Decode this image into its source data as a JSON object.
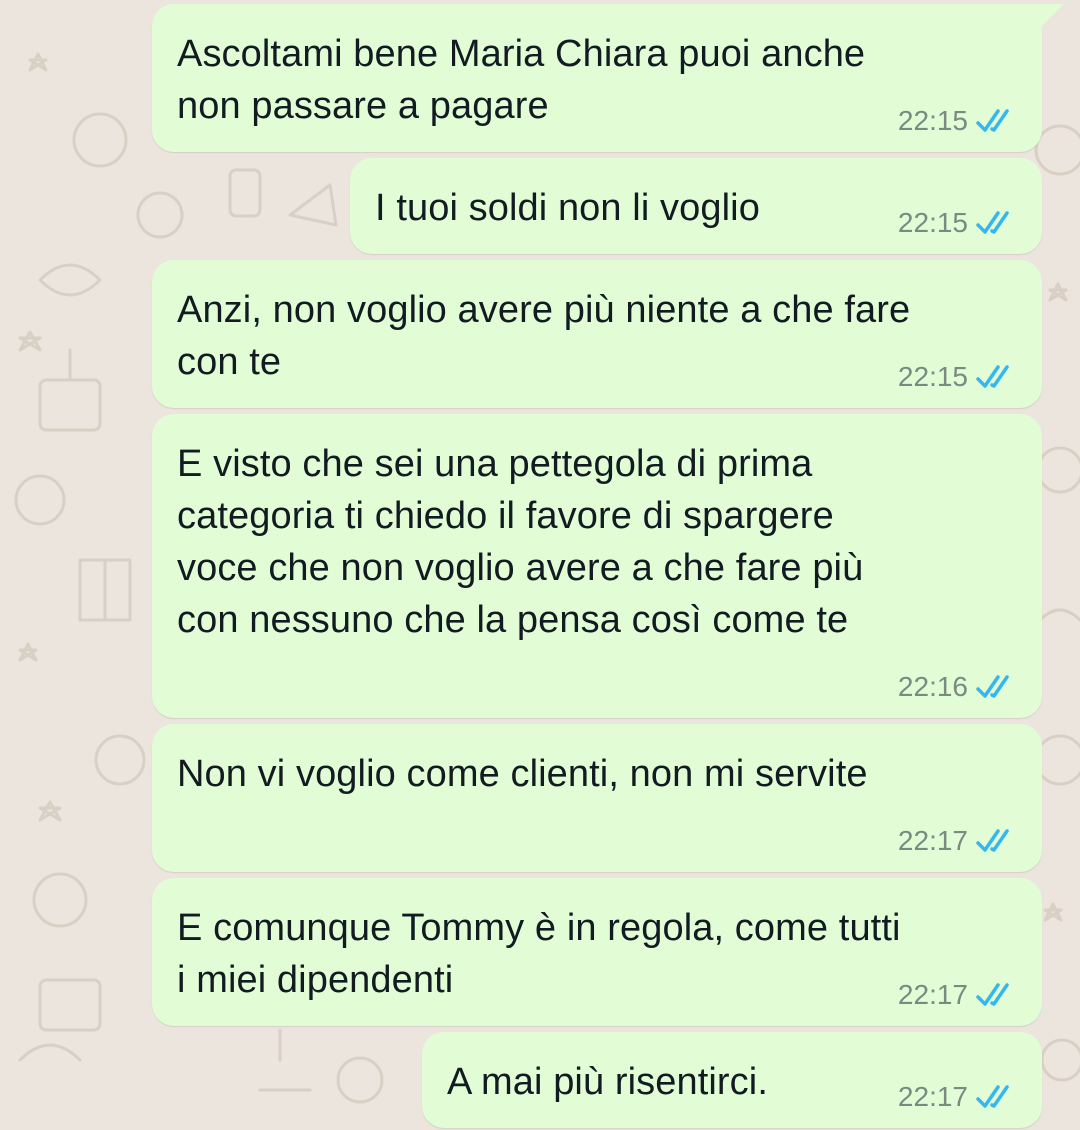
{
  "colors": {
    "wallpaper": "#ece5dd",
    "bubble_outgoing": "#e2fdd6",
    "text": "#111b21",
    "timestamp": "#7a8a80",
    "read_ticks": "#34b7f1"
  },
  "messages": [
    {
      "text": "Ascoltami bene Maria Chiara puoi anche\nnon passare a pagare",
      "time": "22:15",
      "status_icon": "double-check-read-icon"
    },
    {
      "text": "I tuoi soldi non li voglio",
      "time": "22:15",
      "status_icon": "double-check-read-icon"
    },
    {
      "text": "Anzi, non voglio avere più niente a che fare\ncon te",
      "time": "22:15",
      "status_icon": "double-check-read-icon"
    },
    {
      "text": "E visto che sei una pettegola di prima\ncategoria ti chiedo il favore di spargere\nvoce che non voglio avere a che fare più\ncon nessuno che la pensa così come te",
      "time": "22:16",
      "status_icon": "double-check-read-icon"
    },
    {
      "text": "Non vi voglio come clienti, non mi servite",
      "time": "22:17",
      "status_icon": "double-check-read-icon"
    },
    {
      "text": "E comunque Tommy è in regola, come tutti\ni miei dipendenti",
      "time": "22:17",
      "status_icon": "double-check-read-icon"
    },
    {
      "text": "A mai più risentirci.",
      "time": "22:17",
      "status_icon": "double-check-read-icon"
    }
  ]
}
